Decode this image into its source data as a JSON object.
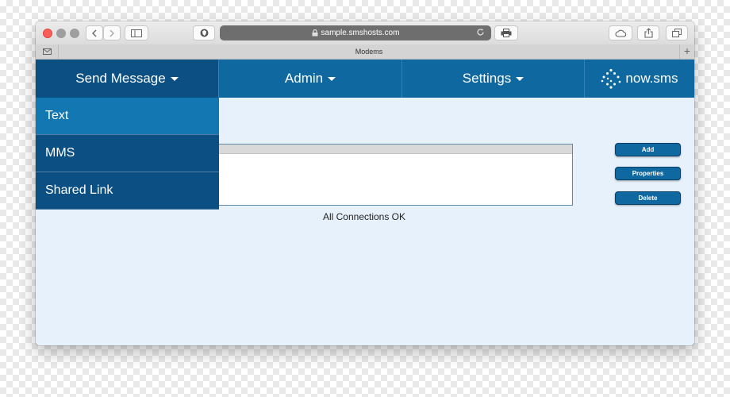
{
  "browser": {
    "url": "sample.smshosts.com",
    "tab_title": "Modems",
    "new_tab_symbol": "+",
    "icons": {
      "back": "chevron-left-icon",
      "forward": "chevron-right-icon",
      "sidebar": "sidebar-icon",
      "shield": "shield-icon",
      "lock": "lock-icon",
      "reload": "reload-icon",
      "print": "printer-icon",
      "cloud": "cloud-icon",
      "share": "share-icon",
      "tabs": "tabs-icon",
      "mail": "mail-icon"
    }
  },
  "nav": {
    "send_message": "Send Message",
    "admin": "Admin",
    "settings": "Settings",
    "brand": "now.sms"
  },
  "dropdown": {
    "items": [
      "Text",
      "MMS",
      "Shared Link"
    ]
  },
  "main": {
    "status": "All Connections OK",
    "add_label": "Add",
    "properties_label": "Properties",
    "delete_label": "Delete"
  },
  "colors": {
    "nav_bg": "#1068a1",
    "nav_active": "#0c4f82",
    "dropdown_active": "#1377b2",
    "content_bg": "#e6f1fc"
  }
}
